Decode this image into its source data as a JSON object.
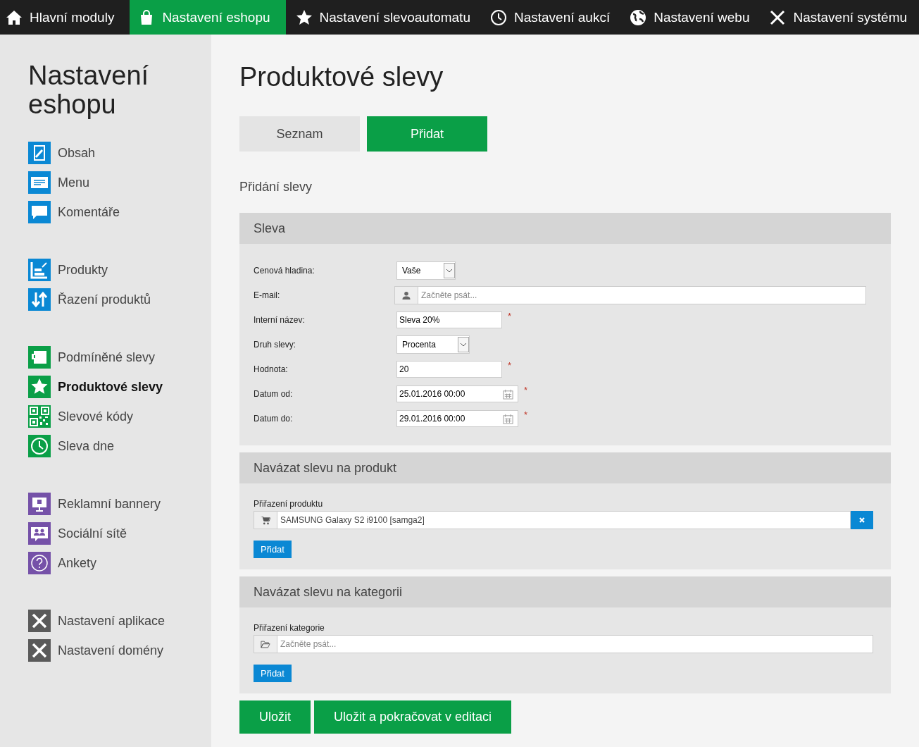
{
  "top_nav": [
    {
      "label": "Hlavní moduly",
      "selected": false
    },
    {
      "label": "Nastavení eshopu",
      "selected": true
    },
    {
      "label": "Nastavení slevoautomatu",
      "selected": false
    },
    {
      "label": "Nastavení aukcí",
      "selected": false
    },
    {
      "label": "Nastavení webu",
      "selected": false
    },
    {
      "label": "Nastavení systému",
      "selected": false
    }
  ],
  "sidebar": {
    "title": "Nastavení eshopu",
    "groups": [
      [
        {
          "label": "Obsah",
          "color": "#0a88d4",
          "selected": false
        },
        {
          "label": "Menu",
          "color": "#0a88d4",
          "selected": false
        },
        {
          "label": "Komentáře",
          "color": "#0a88d4",
          "selected": false
        }
      ],
      [
        {
          "label": "Produkty",
          "color": "#0a88d4",
          "selected": false
        },
        {
          "label": "Řazení produktů",
          "color": "#0a88d4",
          "selected": false
        }
      ],
      [
        {
          "label": "Podmíněné slevy",
          "color": "#0a9f47",
          "selected": false
        },
        {
          "label": "Produktové slevy",
          "color": "#0a9f47",
          "selected": true
        },
        {
          "label": "Slevové kódy",
          "color": "#0a9f47",
          "selected": false
        },
        {
          "label": "Sleva dne",
          "color": "#0a9f47",
          "selected": false
        }
      ],
      [
        {
          "label": "Reklamní bannery",
          "color": "#7551a8",
          "selected": false
        },
        {
          "label": "Sociální sítě",
          "color": "#7551a8",
          "selected": false
        },
        {
          "label": "Ankety",
          "color": "#7551a8",
          "selected": false
        }
      ],
      [
        {
          "label": "Nastavení aplikace",
          "color": "#5a5a5a",
          "selected": false
        },
        {
          "label": "Nastavení domény",
          "color": "#5a5a5a",
          "selected": false
        }
      ]
    ]
  },
  "page_title": "Produktové slevy",
  "tabs": [
    {
      "label": "Seznam",
      "selected": false
    },
    {
      "label": "Přidat",
      "selected": true
    }
  ],
  "subtitle": "Přidání slevy",
  "discount_section": {
    "title": "Sleva",
    "fields": [
      {
        "kind": "select",
        "label": "Cenová hladina:",
        "value": "Vaše",
        "required": false
      },
      {
        "kind": "lookup",
        "label": "E-mail:",
        "placeholder": "Začněte psát...",
        "required": false
      },
      {
        "kind": "text",
        "label": "Interní název:",
        "value": "Sleva 20%",
        "required": true
      },
      {
        "kind": "select",
        "label": "Druh slevy:",
        "value": "Procenta",
        "required": false
      },
      {
        "kind": "text",
        "label": "Hodnota:",
        "value": "20",
        "required": true
      },
      {
        "kind": "date",
        "label": "Datum od:",
        "value": "25.01.2016 00:00",
        "required": true
      },
      {
        "kind": "date",
        "label": "Datum do:",
        "value": "29.01.2016 00:00",
        "required": true
      }
    ]
  },
  "product_section": {
    "title": "Navázat slevu na produkt",
    "label": "Přiřazení produktu",
    "value": "SAMSUNG Galaxy S2 i9100 [samga2]",
    "button": "Přidat"
  },
  "category_section": {
    "title": "Navázat slevu na kategorii",
    "label": "Přiřazení kategorie",
    "placeholder": "Začněte psát...",
    "button": "Přidat"
  },
  "required_marker": "*",
  "footer_buttons": [
    "Uložit",
    "Uložit a pokračovat v editaci"
  ]
}
